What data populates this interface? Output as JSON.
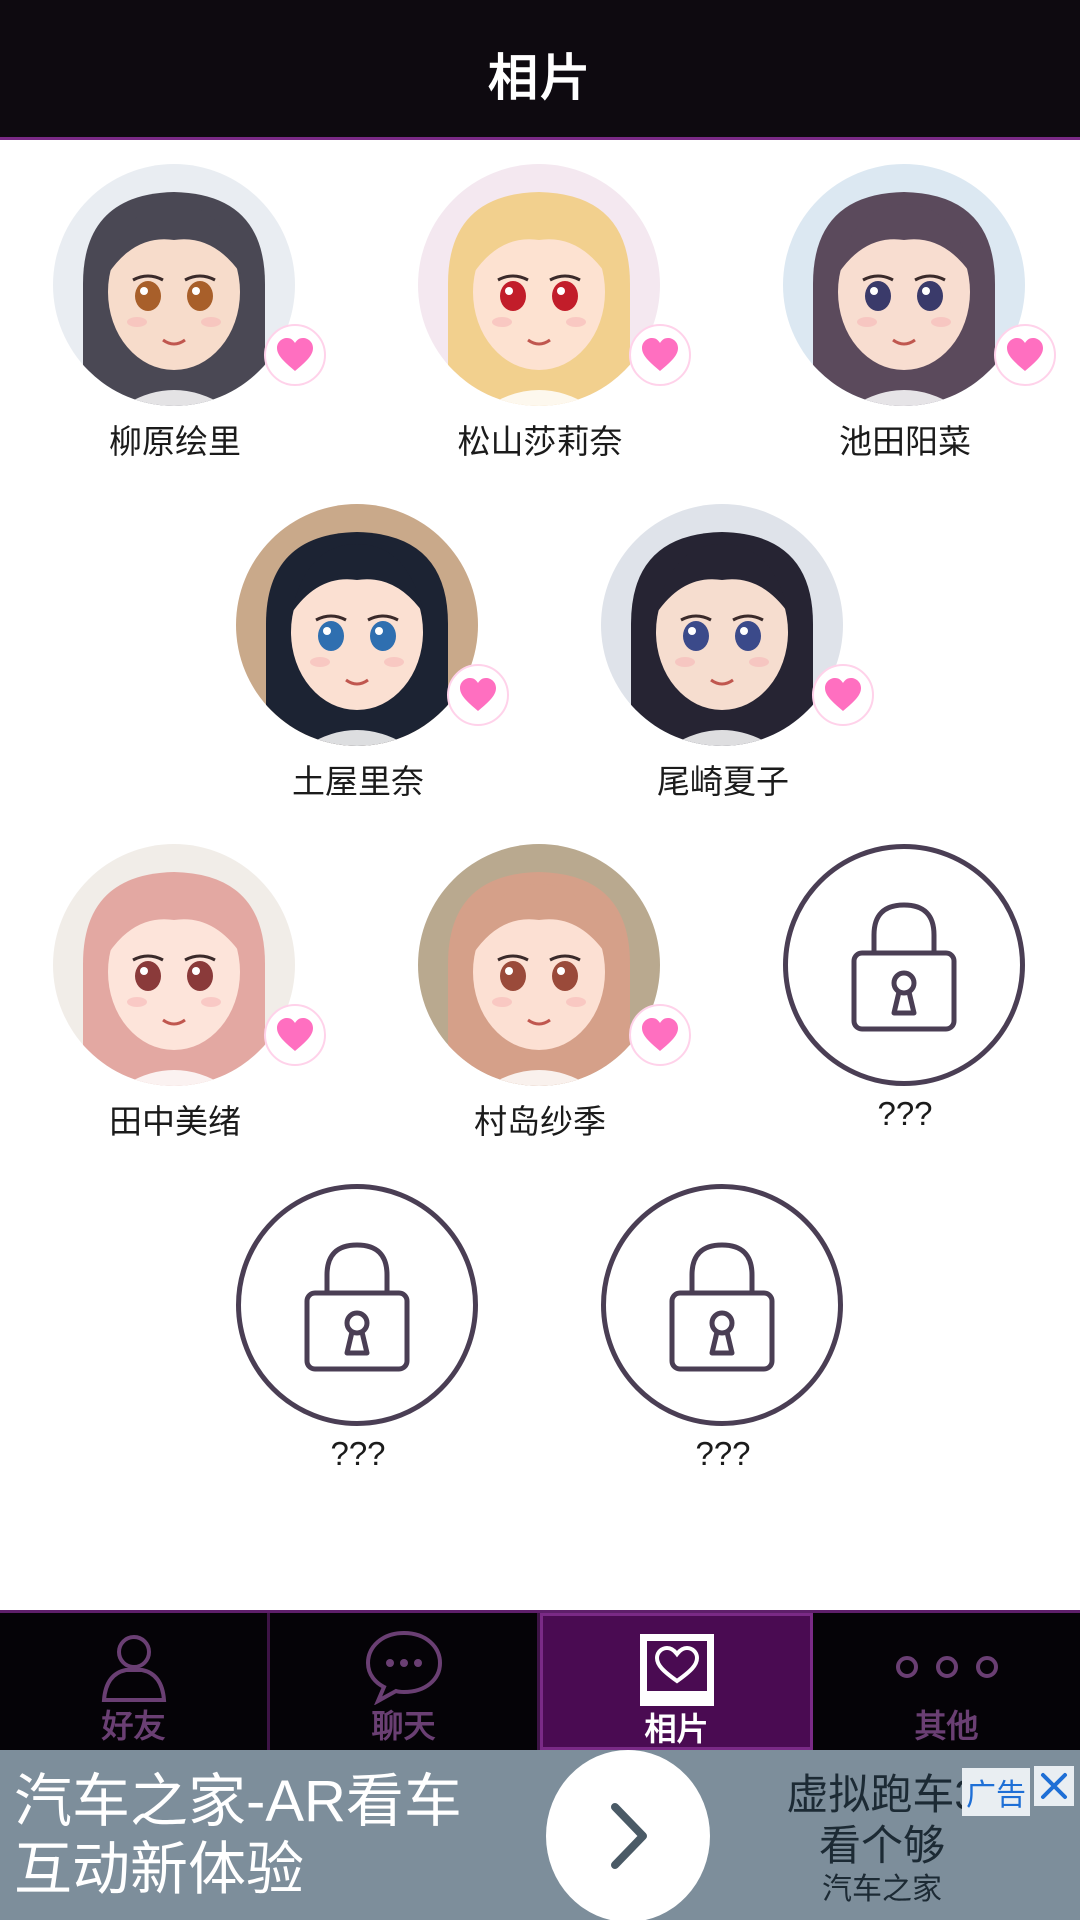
{
  "header": {
    "title": "相片"
  },
  "characters": [
    {
      "name": "柳原绘里",
      "unlocked": true,
      "hair": "#4a4854",
      "skin": "#f7dccb",
      "eyes": "#a85f2a",
      "bg": "#e9edf2"
    },
    {
      "name": "松山莎莉奈",
      "unlocked": true,
      "hair": "#f2d08e",
      "skin": "#fde2d1",
      "eyes": "#c21d2a",
      "bg": "#f4e8f0"
    },
    {
      "name": "池田阳菜",
      "unlocked": true,
      "hair": "#5b4a5c",
      "skin": "#f8ddd0",
      "eyes": "#3a3a6a",
      "bg": "#dce8f2"
    },
    {
      "name": "土屋里奈",
      "unlocked": true,
      "hair": "#1c2333",
      "skin": "#fbe0d2",
      "eyes": "#2f6fb0",
      "bg": "#c9a98a"
    },
    {
      "name": "尾崎夏子",
      "unlocked": true,
      "hair": "#262433",
      "skin": "#f6ddcf",
      "eyes": "#3b4a8a",
      "bg": "#dfe3ea"
    },
    {
      "name": "田中美绪",
      "unlocked": true,
      "hair": "#e3a8a2",
      "skin": "#fde4da",
      "eyes": "#8a3a3a",
      "bg": "#f1ede8"
    },
    {
      "name": "村岛纱季",
      "unlocked": true,
      "hair": "#d5a089",
      "skin": "#fce0d3",
      "eyes": "#9a4a3a",
      "bg": "#b9a98f"
    },
    {
      "name": "???",
      "unlocked": false
    },
    {
      "name": "???",
      "unlocked": false
    },
    {
      "name": "???",
      "unlocked": false
    }
  ],
  "tabs": [
    {
      "label": "好友",
      "icon": "person-icon",
      "active": false
    },
    {
      "label": "聊天",
      "icon": "chat-bubble-icon",
      "active": false
    },
    {
      "label": "相片",
      "icon": "photo-heart-icon",
      "active": true
    },
    {
      "label": "其他",
      "icon": "more-dots-icon",
      "active": false
    }
  ],
  "ad": {
    "line1": "汽车之家-AR看车",
    "line2": "互动新体验",
    "right1": "虚拟跑车3",
    "right2": "看个够",
    "right3": "汽车之家",
    "tag": "广告"
  },
  "colors": {
    "accent": "#7a2a86",
    "active_tab": "#4a0b52",
    "heart": "#ff6fc0",
    "lock": "#4a3e54"
  }
}
